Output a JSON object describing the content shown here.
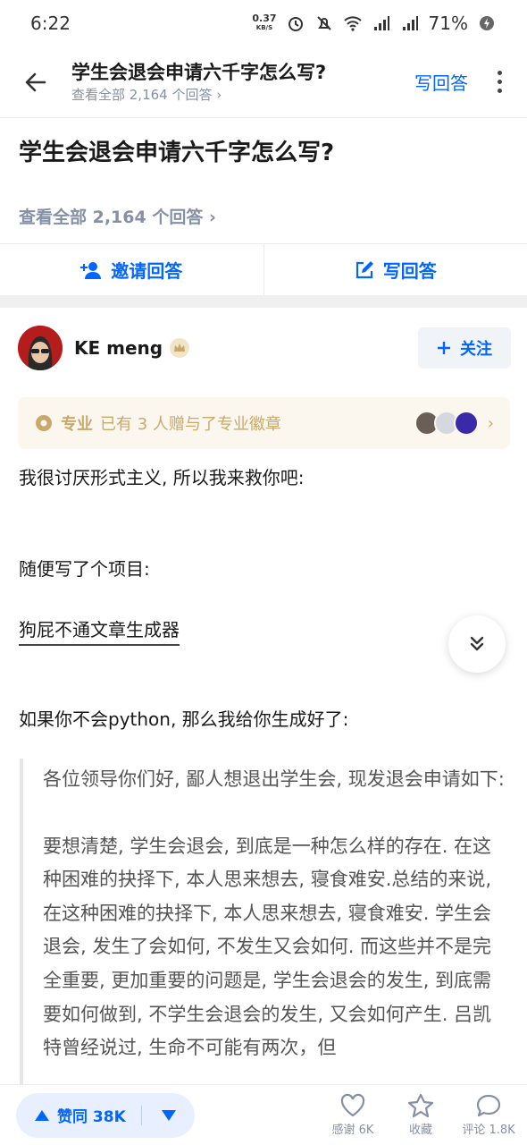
{
  "status_bar": {
    "time": "6:22",
    "speed_value": "0.37",
    "speed_unit": "KB/S",
    "battery": "71%"
  },
  "nav": {
    "title": "学生会退会申请六千字怎么写?",
    "subtitle": "查看全部 2,164 个回答 ›",
    "write_answer": "写回答"
  },
  "question": {
    "title": "学生会退会申请六千字怎么写?",
    "answers_link": "查看全部 2,164 个回答 ›"
  },
  "actions": {
    "invite": "邀请回答",
    "write": "写回答"
  },
  "author": {
    "name": "KE meng",
    "follow": "关注"
  },
  "pro_banner": {
    "label": "专业",
    "text": "已有 3 人赠与了专业徽章"
  },
  "content": {
    "p1": "我很讨厌形式主义, 所以我来救你吧:",
    "p2": "随便写了个项目:",
    "link": "狗屁不通文章生成器",
    "p3": "如果你不会python, 那么我给你生成好了:",
    "quote_p1": "各位领导你们好, 鄙人想退出学生会, 现发退会申请如下:",
    "quote_p2": "要想清楚, 学生会退会, 到底是一种怎么样的存在. 在这种困难的抉择下, 本人思来想去, 寝食难安.总结的来说, 在这种困难的抉择下, 本人思来想去, 寝食难安. 学生会退会, 发生了会如何, 不发生又会如何. 而这些并不是完全重要, 更加重要的问题是, 学生会退会的发生, 到底需要如何做到, 不学生会退会的发生, 又会如何产生. 吕凯特曾经说过, 生命不可能有两次，但"
  },
  "bottom_bar": {
    "upvote": "赞同 38K",
    "thanks": "感谢 6K",
    "collect": "收藏",
    "comment": "评论 1.8K"
  },
  "colors": {
    "accent": "#0066ff",
    "gold": "#c8a96a",
    "muted": "#8590a6"
  }
}
